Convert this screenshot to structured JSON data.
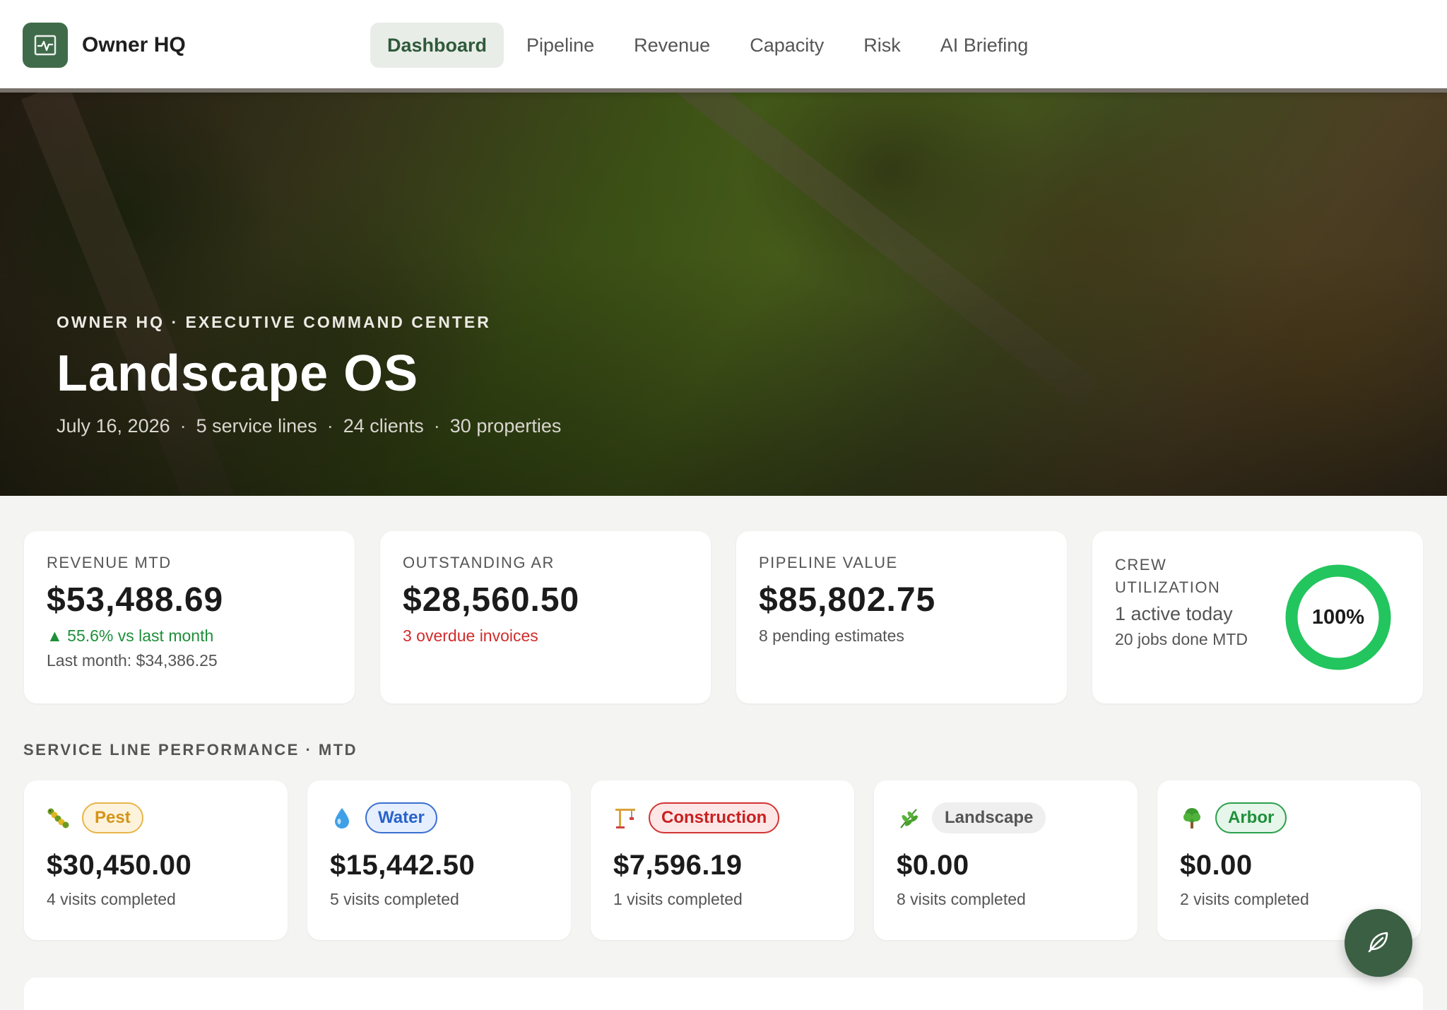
{
  "app": {
    "name": "Owner HQ",
    "logo_icon": "activity-chart-icon",
    "brand_color": "#3f6b4a"
  },
  "nav": {
    "items": [
      {
        "label": "Dashboard",
        "active": true
      },
      {
        "label": "Pipeline",
        "active": false
      },
      {
        "label": "Revenue",
        "active": false
      },
      {
        "label": "Capacity",
        "active": false
      },
      {
        "label": "Risk",
        "active": false
      },
      {
        "label": "AI Briefing",
        "active": false
      }
    ]
  },
  "hero": {
    "eyebrow": "OWNER HQ · EXECUTIVE COMMAND CENTER",
    "title": "Landscape OS",
    "meta": {
      "date": "July 16, 2026",
      "service_lines": "5 service lines",
      "clients": "24 clients",
      "properties": "30 properties",
      "separator": "·"
    }
  },
  "kpis": {
    "revenue": {
      "label": "REVENUE MTD",
      "value": "$53,488.69",
      "change": "▲ 55.6% vs last month",
      "last_month": "Last month: $34,386.25",
      "change_color": "#1f8f3a"
    },
    "ar": {
      "label": "OUTSTANDING AR",
      "value": "$28,560.50",
      "overdue": "3 overdue invoices",
      "overdue_color": "#d12c2c"
    },
    "pipeline": {
      "label": "PIPELINE VALUE",
      "value": "$85,802.75",
      "pending": "8 pending estimates"
    },
    "crew": {
      "label": "CREW UTILIZATION",
      "active": "1 active today",
      "jobs": "20 jobs done MTD",
      "utilization_text": "100%",
      "utilization_fraction": 1.0,
      "ring_color": "#22c55e"
    }
  },
  "service_section": {
    "title": "SERVICE LINE PERFORMANCE · MTD",
    "lines": [
      {
        "name": "Pest",
        "icon": "caterpillar-icon",
        "value": "$30,450.00",
        "visits": "4 visits completed",
        "chip_text": "#d4941a",
        "chip_bg": "#fdf3dc",
        "chip_border": "#e8b54a"
      },
      {
        "name": "Water",
        "icon": "water-drop-icon",
        "value": "$15,442.50",
        "visits": "5 visits completed",
        "chip_text": "#2a62c9",
        "chip_bg": "#e6efff",
        "chip_border": "#3b6fd1"
      },
      {
        "name": "Construction",
        "icon": "crane-icon",
        "value": "$7,596.19",
        "visits": "1 visits completed",
        "chip_text": "#c82121",
        "chip_bg": "#fde6e6",
        "chip_border": "#d23434"
      },
      {
        "name": "Landscape",
        "icon": "herb-icon",
        "value": "$0.00",
        "visits": "8 visits completed",
        "chip_text": "#555555",
        "chip_bg": "#efefef",
        "chip_border": "#efefef"
      },
      {
        "name": "Arbor",
        "icon": "tree-icon",
        "value": "$0.00",
        "visits": "2 visits completed",
        "chip_text": "#1f8f3a",
        "chip_bg": "#e6f6ea",
        "chip_border": "#2aa04a"
      }
    ]
  },
  "fab": {
    "icon": "leaf-icon",
    "color": "#3a5f43"
  }
}
